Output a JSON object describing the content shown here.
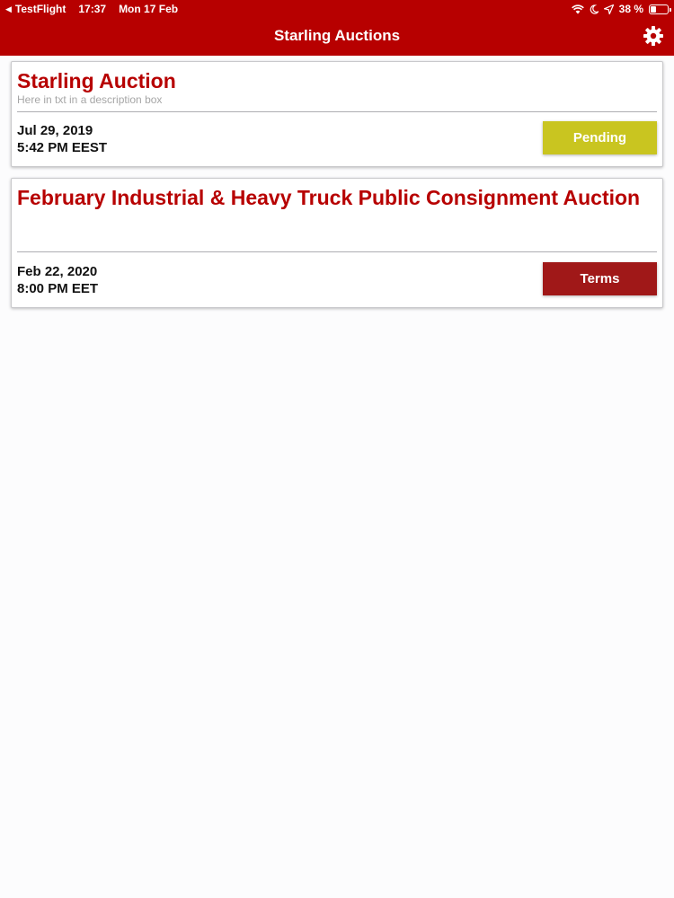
{
  "status_bar": {
    "back_app": "TestFlight",
    "time": "17:37",
    "date": "Mon 17 Feb",
    "battery": "38 %",
    "battery_level": 0.38
  },
  "nav": {
    "title": "Starling Auctions",
    "settings_icon": "gear-icon"
  },
  "auctions": [
    {
      "title": "Starling Auction",
      "description": "Here in txt in a description box",
      "date": "Jul 29, 2019",
      "time": "5:42 PM EEST",
      "button_label": "Pending",
      "button_color": "#c9c520"
    },
    {
      "title": "February Industrial & Heavy Truck Public Consignment Auction",
      "description": "",
      "date": "Feb 22, 2020",
      "time": "8:00 PM EET",
      "button_label": "Terms",
      "button_color": "#a01818"
    }
  ],
  "colors": {
    "brand_red": "#b70000",
    "title_red": "#b70000"
  }
}
